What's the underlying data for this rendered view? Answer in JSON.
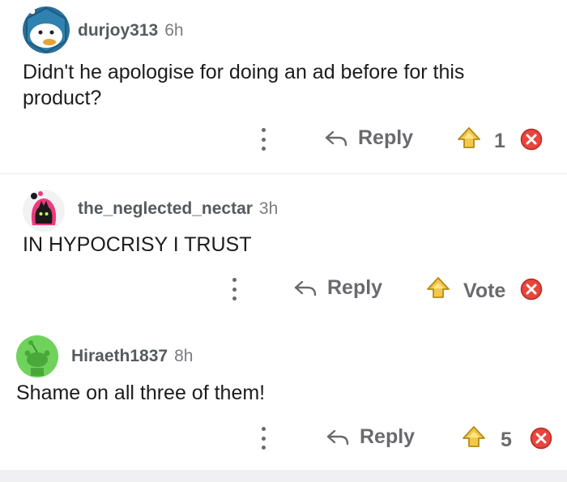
{
  "comments": [
    {
      "username": "durjoy313",
      "age": "6h",
      "text": "Didn't he apologise for doing an ad before for this product?",
      "reply_label": "Reply",
      "vote": "1",
      "avatar": "snoo-duck-avatar"
    },
    {
      "username": "the_neglected_nectar",
      "age": "3h",
      "text": "IN HYPOCRISY I TRUST",
      "reply_label": "Reply",
      "vote": "Vote",
      "avatar": "pink-cat-avatar"
    },
    {
      "username": "Hiraeth1837",
      "age": "8h",
      "text": "Shame on all three of them!",
      "reply_label": "Reply",
      "vote": "5",
      "avatar": "green-snoo-avatar"
    }
  ],
  "colors": {
    "upvote": "#f2c94c",
    "downvote": "#e8453c",
    "muted": "#6a6a6e",
    "avatar_green": "#6fd35b"
  }
}
